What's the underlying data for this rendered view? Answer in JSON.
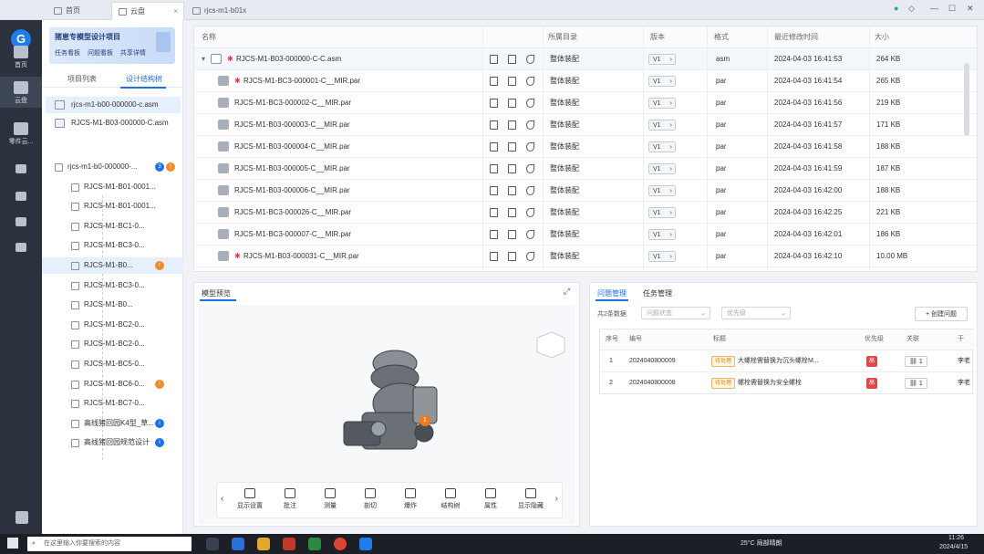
{
  "tabs": [
    {
      "label": "首页"
    },
    {
      "label": "云盘"
    },
    {
      "label": "rjcs-m1-b01x"
    }
  ],
  "rail": {
    "items": [
      {
        "label": "首页"
      },
      {
        "label": "云盘"
      },
      {
        "label": "零件云..."
      }
    ]
  },
  "project": {
    "title": "猪崽专模型设计项目",
    "links": [
      "任务看板",
      "问题看板",
      "共享详情"
    ]
  },
  "left_tabs": [
    "项目列表",
    "设计结构树"
  ],
  "files": [
    "rjcs-m1-b00-000000-c.asm",
    "RJCS-M1-B03-000000-C.asm"
  ],
  "tree": [
    {
      "label": "rjcs-m1-b0-000000-...",
      "badges": [
        {
          "t": "3",
          "c": "blue"
        },
        {
          "t": "!",
          "c": "orange"
        }
      ]
    },
    {
      "label": "RJCS-M1-B01-0001..."
    },
    {
      "label": "RJCS-M1-B01-0001..."
    },
    {
      "label": "RJCS-M1-BC1-0..."
    },
    {
      "label": "RJCS-M1-BC3-0..."
    },
    {
      "label": "RJCS-M1-B0...",
      "badges": [
        {
          "t": "!",
          "c": "orange"
        }
      ]
    },
    {
      "label": "RJCS-M1-BC3-0..."
    },
    {
      "label": "RJCS-M1-B0..."
    },
    {
      "label": "RJCS-M1-BC2-0..."
    },
    {
      "label": "RJCS-M1-BC2-0..."
    },
    {
      "label": "RJCS-M1-BC5-0..."
    },
    {
      "label": "RJCS-M1-BC6-0...",
      "badges": [
        {
          "t": "!",
          "c": "orange"
        }
      ]
    },
    {
      "label": "RJCS-M1-BC7-0..."
    },
    {
      "label": "高线猪回园K4型_草...",
      "badges": [
        {
          "t": "i",
          "c": "blue"
        }
      ]
    },
    {
      "label": "高线猪回园规范设计",
      "badges": [
        {
          "t": "i",
          "c": "blue"
        }
      ]
    }
  ],
  "table": {
    "headers": {
      "name": "名称",
      "dir": "所属目录",
      "version": "版本",
      "format": "格式",
      "modified": "最近修改时间",
      "size": "大小"
    },
    "rows": [
      {
        "name": "RJCS-M1-B03-000000-C-C.asm",
        "dir": "整体装配",
        "version": "V1",
        "format": "asm",
        "modified": "2024-04-03 16:41:53",
        "size": "264 KB"
      },
      {
        "name": "RJCS-M1-BC3-000001-C__MIR.par",
        "dir": "整体装配",
        "version": "V1",
        "format": "par",
        "modified": "2024-04-03 16:41:54",
        "size": "265 KB"
      },
      {
        "name": "RJCS-M1-BC3-000002-C__MIR.par",
        "dir": "整体装配",
        "version": "V1",
        "format": "par",
        "modified": "2024-04-03 16:41:56",
        "size": "219 KB"
      },
      {
        "name": "RJCS-M1-B03-000003-C__MIR.par",
        "dir": "整体装配",
        "version": "V1",
        "format": "par",
        "modified": "2024-04-03 16:41:57",
        "size": "171 KB"
      },
      {
        "name": "RJCS-M1-B03-000004-C__MIR.par",
        "dir": "整体装配",
        "version": "V1",
        "format": "par",
        "modified": "2024-04-03 16:41:58",
        "size": "188 KB"
      },
      {
        "name": "RJCS-M1-B03-000005-C__MIR.par",
        "dir": "整体装配",
        "version": "V1",
        "format": "par",
        "modified": "2024-04-03 16:41:59",
        "size": "187 KB"
      },
      {
        "name": "RJCS-M1-B03-000006-C__MIR.par",
        "dir": "整体装配",
        "version": "V1",
        "format": "par",
        "modified": "2024-04-03 16:42:00",
        "size": "188 KB"
      },
      {
        "name": "RJCS-M1-BC3-000026-C__MIR.par",
        "dir": "整体装配",
        "version": "V1",
        "format": "par",
        "modified": "2024-04-03 16:42:25",
        "size": "221 KB"
      },
      {
        "name": "RJCS-M1-BC3-000007-C__MIR.par",
        "dir": "整体装配",
        "version": "V1",
        "format": "par",
        "modified": "2024-04-03 16:42:01",
        "size": "186 KB"
      },
      {
        "name": "RJCS-M1-B03-000031-C__MIR.par",
        "dir": "整体装配",
        "version": "V1",
        "format": "par",
        "modified": "2024-04-03 16:42:10",
        "size": "10.00 MB"
      }
    ]
  },
  "preview": {
    "title": "模型预览",
    "tools": [
      "显示设置",
      "批注",
      "测量",
      "剖切",
      "爆炸",
      "结构树",
      "属性",
      "显示隐藏"
    ],
    "marker": "1"
  },
  "issues": {
    "tabs": [
      "问题管理",
      "任务管理"
    ],
    "count_text": "共2条数据",
    "filter1": "问题状态",
    "filter2": "优先级",
    "create": "+ 创建问题",
    "headers": {
      "no": "序号",
      "code": "编号",
      "title": "标题",
      "prio": "优先级",
      "link": "关联",
      "owner": "干"
    },
    "rows": [
      {
        "no": "1",
        "code": "2024040800009",
        "status": "待处理",
        "title": "大螺栓需替换为沉头螺栓M...",
        "prio": "高",
        "link": "1",
        "owner": "李老"
      },
      {
        "no": "2",
        "code": "2024040800008",
        "status": "待处理",
        "title": "螺栓需替换为安全螺栓",
        "prio": "高",
        "link": "1",
        "owner": "李老"
      }
    ]
  },
  "taskbar": {
    "search": "在这里输入你要搜索的内容",
    "weather": "25°C 局部晴朗",
    "time": "11:26",
    "date": "2024/4/15"
  }
}
